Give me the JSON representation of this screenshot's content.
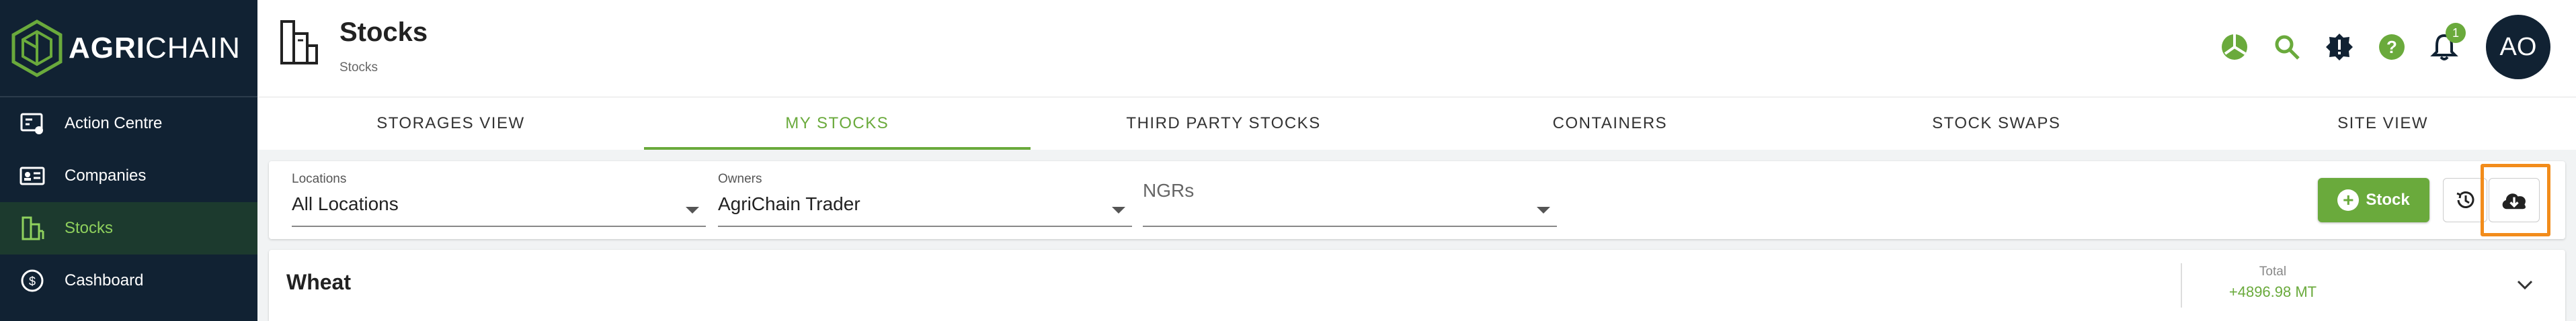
{
  "brand": {
    "bold": "AGRI",
    "light": "CHAIN"
  },
  "sidebar": {
    "items": [
      {
        "label": "Action Centre",
        "icon": "action-centre-icon",
        "active": false
      },
      {
        "label": "Companies",
        "icon": "companies-icon",
        "active": false
      },
      {
        "label": "Stocks",
        "icon": "stocks-icon",
        "active": true
      },
      {
        "label": "Cashboard",
        "icon": "cashboard-icon",
        "active": false
      }
    ]
  },
  "header": {
    "title": "Stocks",
    "breadcrumb": "Stocks",
    "notification_count": "1",
    "avatar_initials": "AO"
  },
  "tabs": [
    {
      "label": "STORAGES VIEW",
      "active": false
    },
    {
      "label": "MY STOCKS",
      "active": true
    },
    {
      "label": "THIRD PARTY STOCKS",
      "active": false
    },
    {
      "label": "CONTAINERS",
      "active": false
    },
    {
      "label": "STOCK SWAPS",
      "active": false
    },
    {
      "label": "SITE VIEW",
      "active": false
    }
  ],
  "filters": {
    "locations": {
      "label": "Locations",
      "value": "All Locations"
    },
    "owners": {
      "label": "Owners",
      "value": "AgriChain Trader"
    },
    "ngrs": {
      "placeholder": "NGRs"
    }
  },
  "actions": {
    "add_stock_label": "Stock"
  },
  "commodity": {
    "name": "Wheat",
    "total_label": "Total",
    "total_value": "+4896.98 MT"
  },
  "colors": {
    "sidebar_bg": "#112233",
    "accent_green": "#6aaa3c",
    "highlight_orange": "#f28c1b"
  }
}
